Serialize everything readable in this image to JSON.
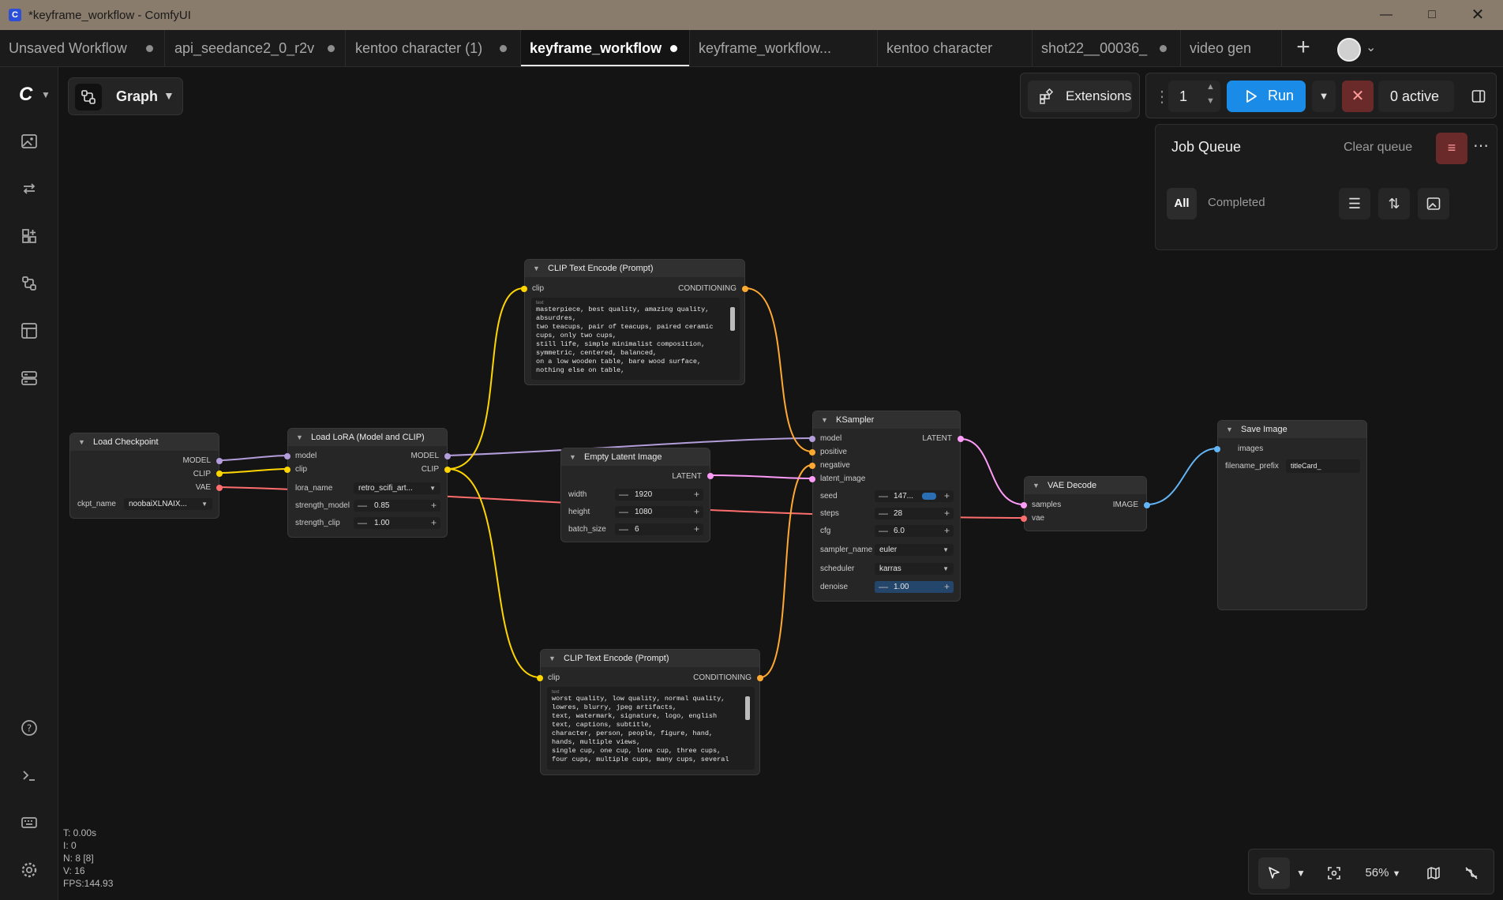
{
  "window": {
    "title": "*keyframe_workflow - ComfyUI",
    "app_icon": "comfyui-logo-icon"
  },
  "tabs": [
    {
      "label": "Unsaved Workflow",
      "unsaved": true
    },
    {
      "label": "api_seedance2_0_r2v",
      "unsaved": true
    },
    {
      "label": "kentoo character (1)",
      "unsaved": true
    },
    {
      "label": "keyframe_workflow",
      "unsaved": true,
      "active": true
    },
    {
      "label": "keyframe_workflow...",
      "unsaved": false
    },
    {
      "label": "kentoo character",
      "unsaved": false
    },
    {
      "label": "shot22__00036_",
      "unsaved": true
    },
    {
      "label": "video gen",
      "unsaved": false
    }
  ],
  "toolbar": {
    "graph_label": "Graph",
    "extensions_label": "Extensions",
    "run_count": "1",
    "run_label": "Run",
    "active_label": "0 active",
    "accent": "#1a8ce8"
  },
  "job_queue": {
    "title": "Job Queue",
    "clear_label": "Clear queue",
    "filter_all": "All",
    "filter_completed": "Completed"
  },
  "nodes": {
    "load_checkpoint": {
      "title": "Load Checkpoint",
      "outputs": [
        "MODEL",
        "CLIP",
        "VAE"
      ],
      "ckpt_name_label": "ckpt_name",
      "ckpt_name": "noobaiXLNAIX..."
    },
    "load_lora": {
      "title": "Load LoRA (Model and CLIP)",
      "in_model": "model",
      "in_clip": "clip",
      "out_model": "MODEL",
      "out_clip": "CLIP",
      "lora_name_label": "lora_name",
      "lora_name": "retro_scifi_art...",
      "strength_model_label": "strength_model",
      "strength_model": "0.85",
      "strength_clip_label": "strength_clip",
      "strength_clip": "1.00"
    },
    "clip_pos": {
      "title": "CLIP Text Encode (Prompt)",
      "in_clip": "clip",
      "out": "CONDITIONING",
      "text_label": "text",
      "text": "masterpiece, best quality, amazing quality, absurdres,\ntwo teacups, pair of teacups, paired ceramic cups, only two cups,\nstill life, simple minimalist composition, symmetric, centered, balanced,\non a low wooden table, bare wood surface,\nnothing else on table,"
    },
    "clip_neg": {
      "title": "CLIP Text Encode (Prompt)",
      "in_clip": "clip",
      "out": "CONDITIONING",
      "text_label": "text",
      "text": "worst quality, low quality, normal quality, lowres, blurry, jpeg artifacts,\ntext, watermark, signature, logo, english text, captions, subtitle,\ncharacter, person, people, figure, hand, hands, multiple views,\nsingle cup, one cup, lone cup, three cups, four cups, multiple cups, many cups, several"
    },
    "empty_latent": {
      "title": "Empty Latent Image",
      "out": "LATENT",
      "width_label": "width",
      "width": "1920",
      "height_label": "height",
      "height": "1080",
      "batch_label": "batch_size",
      "batch": "6"
    },
    "ksampler": {
      "title": "KSampler",
      "in_model": "model",
      "in_positive": "positive",
      "in_negative": "negative",
      "in_latent": "latent_image",
      "out": "LATENT",
      "seed_label": "seed",
      "seed": "147...",
      "steps_label": "steps",
      "steps": "28",
      "cfg_label": "cfg",
      "cfg": "6.0",
      "sampler_label": "sampler_name",
      "sampler": "euler",
      "scheduler_label": "scheduler",
      "scheduler": "karras",
      "denoise_label": "denoise",
      "denoise": "1.00"
    },
    "vae_decode": {
      "title": "VAE Decode",
      "in_samples": "samples",
      "in_vae": "vae",
      "out": "IMAGE"
    },
    "save_image": {
      "title": "Save Image",
      "in_images": "images",
      "prefix_label": "filename_prefix",
      "prefix": "titleCard_"
    }
  },
  "link_colors": {
    "model": "#b39ddb",
    "clip": "#ffd500",
    "vae": "#ff6e6e",
    "conditioning": "#ffa931",
    "latent": "#ff9cf9",
    "image": "#64b5f6"
  },
  "stats": {
    "t": "T: 0.00s",
    "i": "I: 0",
    "n": "N: 8 [8]",
    "v": "V: 16",
    "fps": "FPS:144.93"
  },
  "bottom_toolbar": {
    "zoom": "56%"
  }
}
